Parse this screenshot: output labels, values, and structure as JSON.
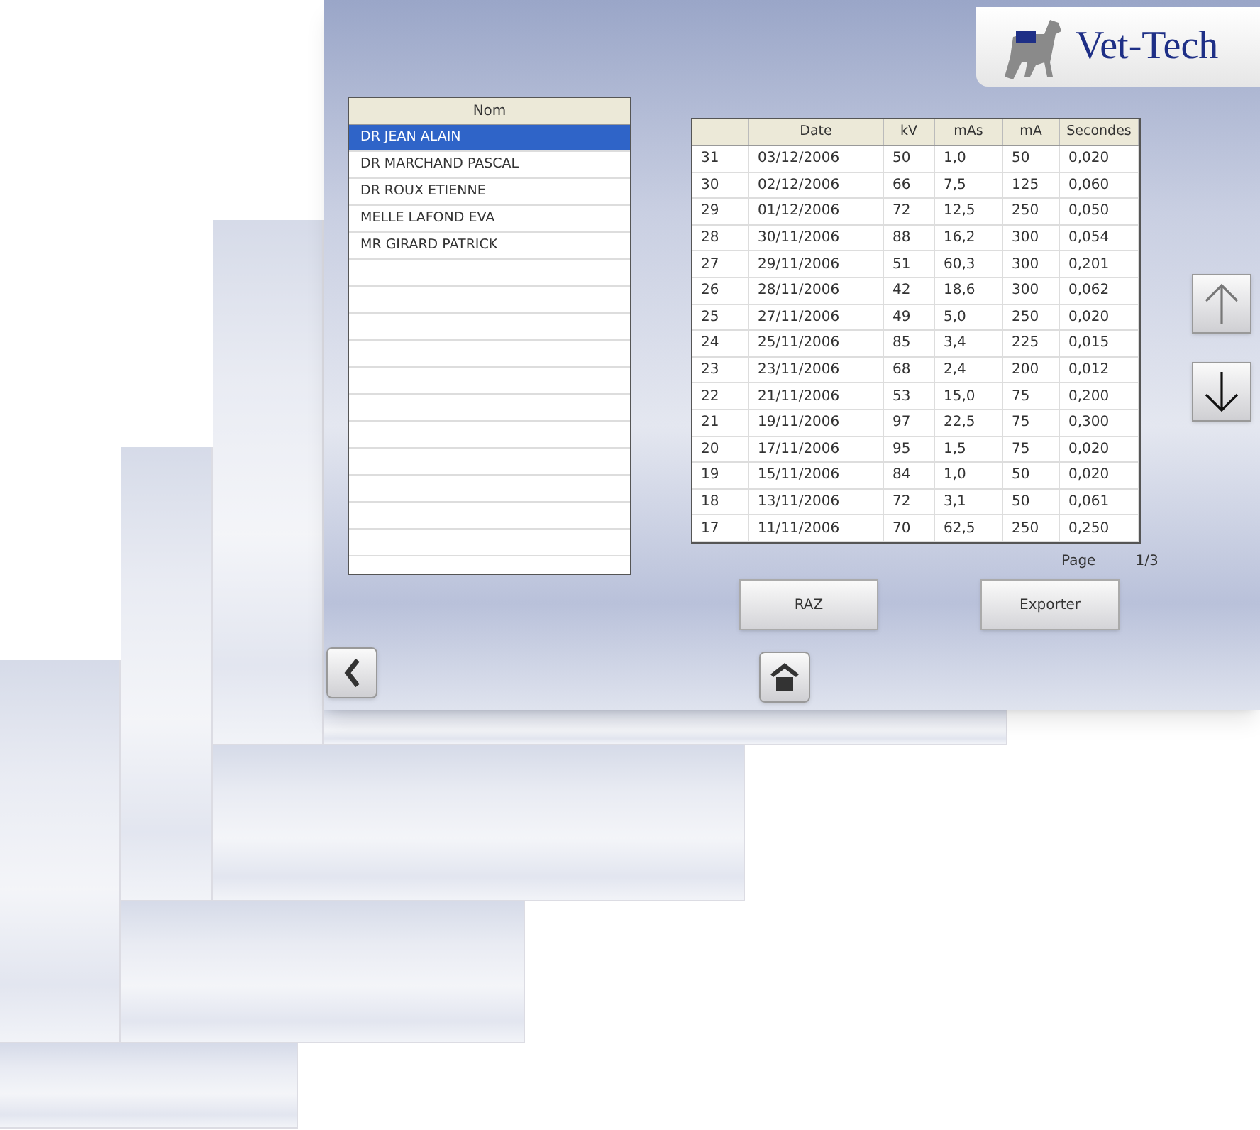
{
  "logo": {
    "text": "Vet-Tech"
  },
  "patients": {
    "header": "Nom",
    "items": [
      {
        "name": "DR JEAN ALAIN",
        "selected": true
      },
      {
        "name": "DR MARCHAND PASCAL",
        "selected": false
      },
      {
        "name": "DR ROUX ETIENNE",
        "selected": false
      },
      {
        "name": "MELLE LAFOND EVA",
        "selected": false
      },
      {
        "name": "MR GIRARD PATRICK",
        "selected": false
      }
    ]
  },
  "table": {
    "columns": [
      "",
      "Date",
      "kV",
      "mAs",
      "mA",
      "Secondes"
    ],
    "rows": [
      [
        "31",
        "03/12/2006",
        "50",
        "1,0",
        "50",
        "0,020"
      ],
      [
        "30",
        "02/12/2006",
        "66",
        "7,5",
        "125",
        "0,060"
      ],
      [
        "29",
        "01/12/2006",
        "72",
        "12,5",
        "250",
        "0,050"
      ],
      [
        "28",
        "30/11/2006",
        "88",
        "16,2",
        "300",
        "0,054"
      ],
      [
        "27",
        "29/11/2006",
        "51",
        "60,3",
        "300",
        "0,201"
      ],
      [
        "26",
        "28/11/2006",
        "42",
        "18,6",
        "300",
        "0,062"
      ],
      [
        "25",
        "27/11/2006",
        "49",
        "5,0",
        "250",
        "0,020"
      ],
      [
        "24",
        "25/11/2006",
        "85",
        "3,4",
        "225",
        "0,015"
      ],
      [
        "23",
        "23/11/2006",
        "68",
        "2,4",
        "200",
        "0,012"
      ],
      [
        "22",
        "21/11/2006",
        "53",
        "15,0",
        "75",
        "0,200"
      ],
      [
        "21",
        "19/11/2006",
        "97",
        "22,5",
        "75",
        "0,300"
      ],
      [
        "20",
        "17/11/2006",
        "95",
        "1,5",
        "75",
        "0,020"
      ],
      [
        "19",
        "15/11/2006",
        "84",
        "1,0",
        "50",
        "0,020"
      ],
      [
        "18",
        "13/11/2006",
        "72",
        "3,1",
        "50",
        "0,061"
      ],
      [
        "17",
        "11/11/2006",
        "70",
        "62,5",
        "250",
        "0,250"
      ]
    ]
  },
  "pager": {
    "label": "Page",
    "value": "1/3"
  },
  "buttons": [
    "RAZ",
    "Exporter"
  ]
}
